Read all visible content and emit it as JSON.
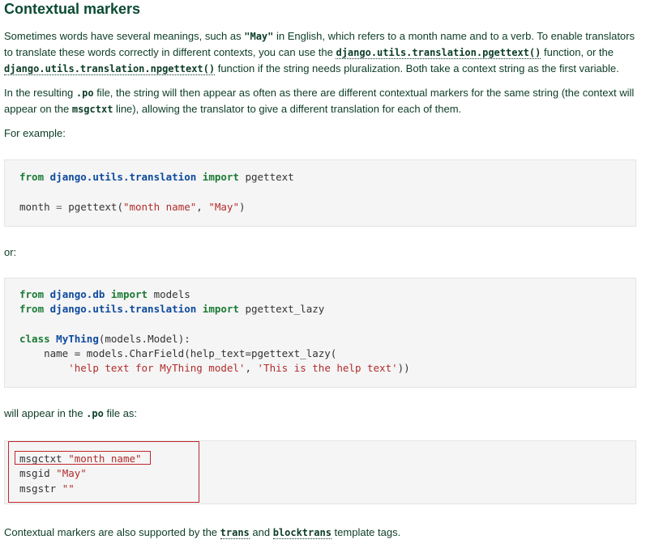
{
  "heading": "Contextual markers",
  "intro": {
    "t1": "Sometimes words have several meanings, such as ",
    "c1": "\"May\"",
    "t2": " in English, which refers to a month name and to a verb. To enable translators to translate these words correctly in different contexts, you can use the ",
    "link1": "django.utils.translation.pgettext()",
    "t3": " function, or the ",
    "link2": "django.utils.translation.npgettext()",
    "t4": " function if the string needs pluralization. Both take a context string as the first variable."
  },
  "resulting": {
    "t1": "In the resulting ",
    "c1": ".po",
    "t2": " file, the string will then appear as often as there are different contextual markers for the same string (the context will appear on the ",
    "c2": "msgctxt",
    "t3": " line), allowing the translator to give a different translation for each of them."
  },
  "for_example": "For example:",
  "code1": {
    "l1_kw1": "from",
    "l1_mod": "django.utils.translation",
    "l1_kw2": "import",
    "l1_name": "pgettext",
    "l2_var": "month",
    "l2_eq": "=",
    "l2_fn": "pgettext(",
    "l2_s1": "\"month name\"",
    "l2_comma": ", ",
    "l2_s2": "\"May\"",
    "l2_close": ")"
  },
  "or_text": "or:",
  "code2": {
    "l1_kw1": "from",
    "l1_mod": "django.db",
    "l1_kw2": "import",
    "l1_name": "models",
    "l2_kw1": "from",
    "l2_mod": "django.utils.translation",
    "l2_kw2": "import",
    "l2_name": "pgettext_lazy",
    "l3_kw": "class",
    "l3_cls": "MyThing",
    "l3_rest": "(models.Model):",
    "l4_code": "    name = models.CharField(help_text=pgettext_lazy(",
    "l5_indent": "        ",
    "l5_s1": "'help text for MyThing model'",
    "l5_comma": ", ",
    "l5_s2": "'This is the help text'",
    "l5_close": "))"
  },
  "will_appear": {
    "t1": "will appear in the ",
    "c1": ".po",
    "t2": " file as:"
  },
  "code3": {
    "l1_key": "msgctxt",
    "l1_val": "\"month name\"",
    "l2_key": "msgid",
    "l2_val": "\"May\"",
    "l3_key": "msgstr",
    "l3_val": "\"\""
  },
  "closing": {
    "t1": "Contextual markers are also supported by the ",
    "link1": "trans",
    "t2": " and ",
    "link2": "blocktrans",
    "t3": " template tags."
  },
  "colors": {
    "heading": "#0c4b33",
    "keyword": "#1b7a35",
    "module": "#0e4a9e",
    "string": "#b22c2c",
    "highlight_box": "#c1272d",
    "code_bg": "#f5f5f5"
  }
}
